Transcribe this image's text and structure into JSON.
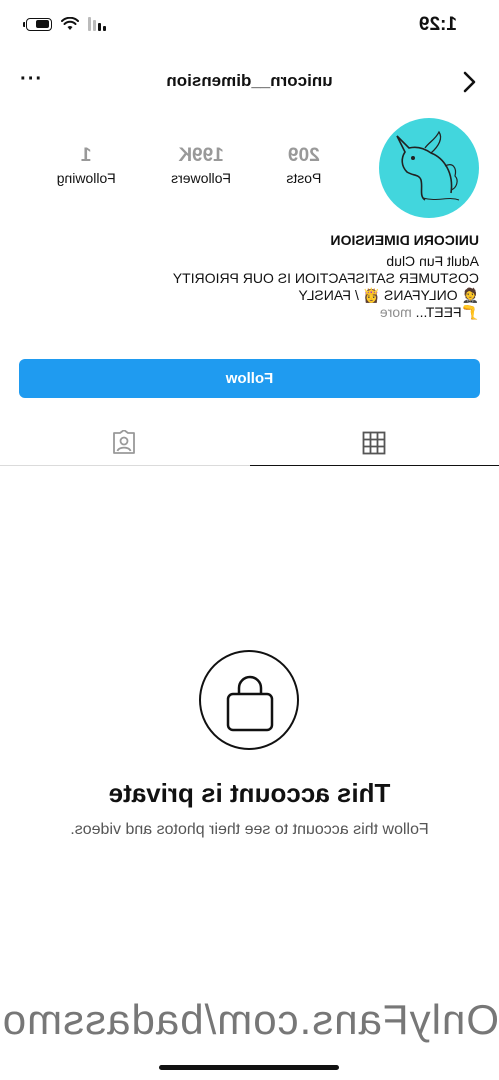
{
  "status_bar": {
    "time": "1:29"
  },
  "nav": {
    "username": "unicorn__dimension",
    "more": "···"
  },
  "profile": {
    "avatar_color": "#42d6dd",
    "stats": [
      {
        "value": "209",
        "label": "Posts"
      },
      {
        "value": "199K",
        "label": "Followers"
      },
      {
        "value": "1",
        "label": "Following"
      }
    ],
    "bio": {
      "name": "UNICORN DIMENSION",
      "lines": [
        "Adult Fun Club",
        "COSTUMER SATISFACTION IS OUR PRIORITY",
        "🤵 ONLYFANS 👸 / FANSLY",
        "🦵FEET... more"
      ],
      "more_label": "more"
    },
    "follow_label": "Follow"
  },
  "tabs": [
    {
      "icon": "grid-icon",
      "active": true
    },
    {
      "icon": "tagged-icon",
      "active": false
    }
  ],
  "private_notice": {
    "title": "This account is private",
    "subtitle": "Follow this account to see their photos and videos."
  },
  "watermark": "OnlyFans.com/badassmom"
}
